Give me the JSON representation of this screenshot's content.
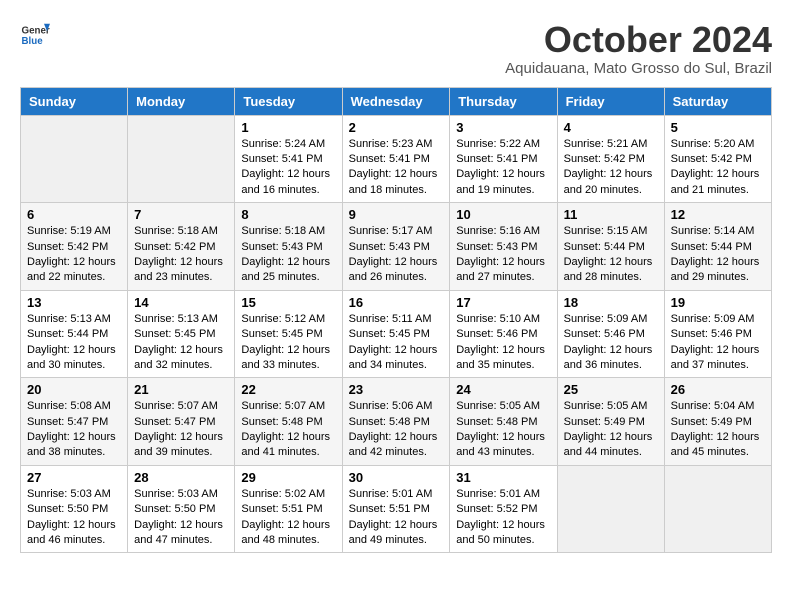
{
  "logo": {
    "line1": "General",
    "line2": "Blue"
  },
  "title": "October 2024",
  "subtitle": "Aquidauana, Mato Grosso do Sul, Brazil",
  "days": [
    "Sunday",
    "Monday",
    "Tuesday",
    "Wednesday",
    "Thursday",
    "Friday",
    "Saturday"
  ],
  "weeks": [
    [
      {
        "day": "",
        "content": ""
      },
      {
        "day": "",
        "content": ""
      },
      {
        "day": "1",
        "content": "Sunrise: 5:24 AM\nSunset: 5:41 PM\nDaylight: 12 hours and 16 minutes."
      },
      {
        "day": "2",
        "content": "Sunrise: 5:23 AM\nSunset: 5:41 PM\nDaylight: 12 hours and 18 minutes."
      },
      {
        "day": "3",
        "content": "Sunrise: 5:22 AM\nSunset: 5:41 PM\nDaylight: 12 hours and 19 minutes."
      },
      {
        "day": "4",
        "content": "Sunrise: 5:21 AM\nSunset: 5:42 PM\nDaylight: 12 hours and 20 minutes."
      },
      {
        "day": "5",
        "content": "Sunrise: 5:20 AM\nSunset: 5:42 PM\nDaylight: 12 hours and 21 minutes."
      }
    ],
    [
      {
        "day": "6",
        "content": "Sunrise: 5:19 AM\nSunset: 5:42 PM\nDaylight: 12 hours and 22 minutes."
      },
      {
        "day": "7",
        "content": "Sunrise: 5:18 AM\nSunset: 5:42 PM\nDaylight: 12 hours and 23 minutes."
      },
      {
        "day": "8",
        "content": "Sunrise: 5:18 AM\nSunset: 5:43 PM\nDaylight: 12 hours and 25 minutes."
      },
      {
        "day": "9",
        "content": "Sunrise: 5:17 AM\nSunset: 5:43 PM\nDaylight: 12 hours and 26 minutes."
      },
      {
        "day": "10",
        "content": "Sunrise: 5:16 AM\nSunset: 5:43 PM\nDaylight: 12 hours and 27 minutes."
      },
      {
        "day": "11",
        "content": "Sunrise: 5:15 AM\nSunset: 5:44 PM\nDaylight: 12 hours and 28 minutes."
      },
      {
        "day": "12",
        "content": "Sunrise: 5:14 AM\nSunset: 5:44 PM\nDaylight: 12 hours and 29 minutes."
      }
    ],
    [
      {
        "day": "13",
        "content": "Sunrise: 5:13 AM\nSunset: 5:44 PM\nDaylight: 12 hours and 30 minutes."
      },
      {
        "day": "14",
        "content": "Sunrise: 5:13 AM\nSunset: 5:45 PM\nDaylight: 12 hours and 32 minutes."
      },
      {
        "day": "15",
        "content": "Sunrise: 5:12 AM\nSunset: 5:45 PM\nDaylight: 12 hours and 33 minutes."
      },
      {
        "day": "16",
        "content": "Sunrise: 5:11 AM\nSunset: 5:45 PM\nDaylight: 12 hours and 34 minutes."
      },
      {
        "day": "17",
        "content": "Sunrise: 5:10 AM\nSunset: 5:46 PM\nDaylight: 12 hours and 35 minutes."
      },
      {
        "day": "18",
        "content": "Sunrise: 5:09 AM\nSunset: 5:46 PM\nDaylight: 12 hours and 36 minutes."
      },
      {
        "day": "19",
        "content": "Sunrise: 5:09 AM\nSunset: 5:46 PM\nDaylight: 12 hours and 37 minutes."
      }
    ],
    [
      {
        "day": "20",
        "content": "Sunrise: 5:08 AM\nSunset: 5:47 PM\nDaylight: 12 hours and 38 minutes."
      },
      {
        "day": "21",
        "content": "Sunrise: 5:07 AM\nSunset: 5:47 PM\nDaylight: 12 hours and 39 minutes."
      },
      {
        "day": "22",
        "content": "Sunrise: 5:07 AM\nSunset: 5:48 PM\nDaylight: 12 hours and 41 minutes."
      },
      {
        "day": "23",
        "content": "Sunrise: 5:06 AM\nSunset: 5:48 PM\nDaylight: 12 hours and 42 minutes."
      },
      {
        "day": "24",
        "content": "Sunrise: 5:05 AM\nSunset: 5:48 PM\nDaylight: 12 hours and 43 minutes."
      },
      {
        "day": "25",
        "content": "Sunrise: 5:05 AM\nSunset: 5:49 PM\nDaylight: 12 hours and 44 minutes."
      },
      {
        "day": "26",
        "content": "Sunrise: 5:04 AM\nSunset: 5:49 PM\nDaylight: 12 hours and 45 minutes."
      }
    ],
    [
      {
        "day": "27",
        "content": "Sunrise: 5:03 AM\nSunset: 5:50 PM\nDaylight: 12 hours and 46 minutes."
      },
      {
        "day": "28",
        "content": "Sunrise: 5:03 AM\nSunset: 5:50 PM\nDaylight: 12 hours and 47 minutes."
      },
      {
        "day": "29",
        "content": "Sunrise: 5:02 AM\nSunset: 5:51 PM\nDaylight: 12 hours and 48 minutes."
      },
      {
        "day": "30",
        "content": "Sunrise: 5:01 AM\nSunset: 5:51 PM\nDaylight: 12 hours and 49 minutes."
      },
      {
        "day": "31",
        "content": "Sunrise: 5:01 AM\nSunset: 5:52 PM\nDaylight: 12 hours and 50 minutes."
      },
      {
        "day": "",
        "content": ""
      },
      {
        "day": "",
        "content": ""
      }
    ]
  ]
}
